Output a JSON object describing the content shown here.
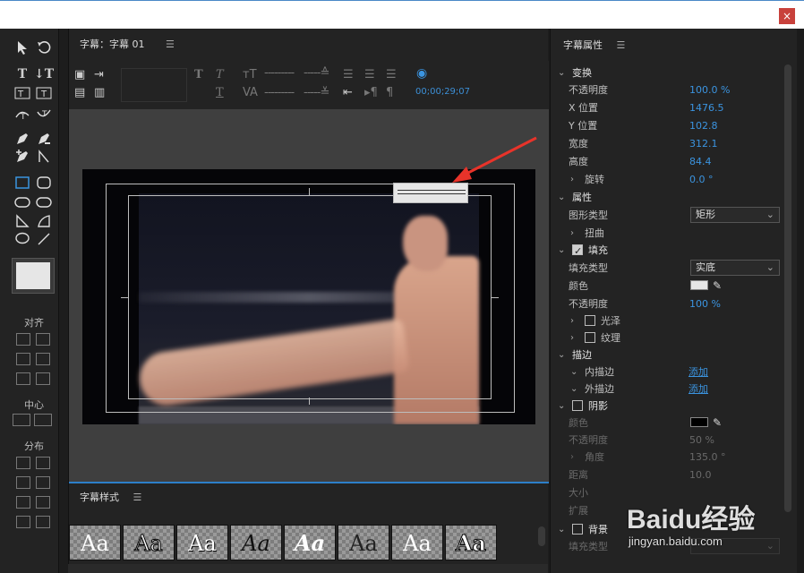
{
  "window": {
    "close_label": "×"
  },
  "title_editor": {
    "header": "字幕：字幕 01",
    "menu_icon": "hamburger-icon",
    "timecode": "00;00;29;07"
  },
  "tools": {
    "group_align": "对齐",
    "group_center": "中心",
    "group_distribute": "分布"
  },
  "styles_panel": {
    "header": "字幕样式",
    "tiles": [
      "Aa",
      "Aa",
      "Aa",
      "Aa",
      "Aa",
      "Aa",
      "Aa",
      "Aa"
    ]
  },
  "properties": {
    "header": "字幕属性",
    "transform": {
      "section": "变换",
      "opacity_label": "不透明度",
      "opacity": "100.0 %",
      "x_label": "X 位置",
      "x": "1476.5",
      "y_label": "Y 位置",
      "y": "102.8",
      "width_label": "宽度",
      "width": "312.1",
      "height_label": "高度",
      "height": "84.4",
      "rotation_label": "旋转",
      "rotation": "0.0 °"
    },
    "attributes": {
      "section": "属性",
      "shape_type_label": "图形类型",
      "shape_type": "矩形",
      "distort_label": "扭曲"
    },
    "fill": {
      "section": "填充",
      "fill_type_label": "填充类型",
      "fill_type": "实底",
      "color_label": "颜色",
      "color": "#e6e6e6",
      "opacity_label": "不透明度",
      "opacity": "100 %",
      "sheen_label": "光泽",
      "texture_label": "纹理"
    },
    "stroke": {
      "section": "描边",
      "inner_label": "内描边",
      "inner_action": "添加",
      "outer_label": "外描边",
      "outer_action": "添加"
    },
    "shadow": {
      "section": "阴影",
      "color_label": "颜色",
      "color": "#000000",
      "opacity_label": "不透明度",
      "opacity": "50 %",
      "angle_label": "角度",
      "angle": "135.0 °",
      "distance_label": "距离",
      "distance": "10.0",
      "size_label": "大小",
      "spread_label": "扩展"
    },
    "background": {
      "section": "背景",
      "fill_type_label": "填充类型"
    }
  },
  "watermark": {
    "main": "Baidu经验",
    "sub": "jingyan.baidu.com"
  },
  "colors": {
    "accent": "#3b94e0",
    "panel": "#232323",
    "arrow": "#e8332a"
  }
}
